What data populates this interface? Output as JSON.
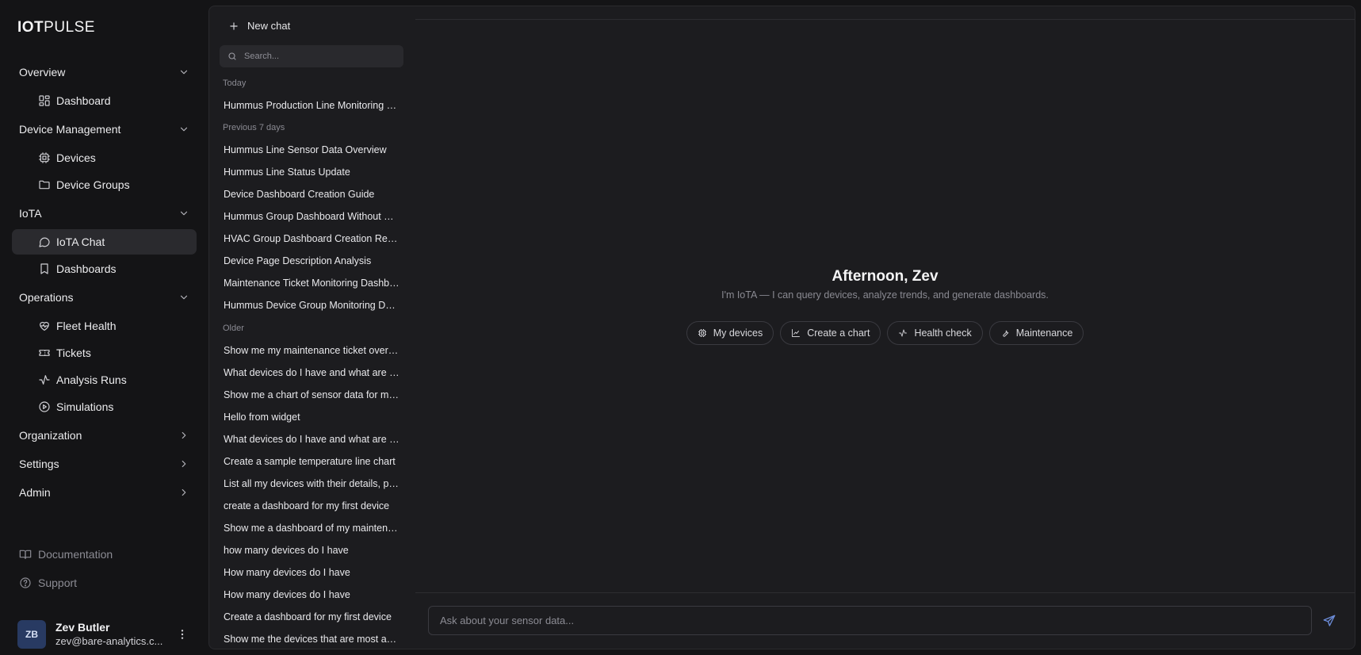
{
  "brand": {
    "bold": "IOT",
    "light": "PULSE"
  },
  "nav": {
    "groups": [
      {
        "label": "Overview",
        "items": [
          {
            "label": "Dashboard",
            "icon": "layout-dashboard-icon"
          }
        ]
      },
      {
        "label": "Device Management",
        "items": [
          {
            "label": "Devices",
            "icon": "cpu-icon"
          },
          {
            "label": "Device Groups",
            "icon": "folder-icon"
          }
        ]
      },
      {
        "label": "IoTA",
        "items": [
          {
            "label": "IoTA Chat",
            "icon": "message-circle-icon",
            "active": true
          },
          {
            "label": "Dashboards",
            "icon": "bookmark-icon"
          }
        ]
      },
      {
        "label": "Operations",
        "items": [
          {
            "label": "Fleet Health",
            "icon": "heart-pulse-icon"
          },
          {
            "label": "Tickets",
            "icon": "ticket-icon"
          },
          {
            "label": "Analysis Runs",
            "icon": "activity-icon"
          },
          {
            "label": "Simulations",
            "icon": "play-circle-icon"
          }
        ]
      },
      {
        "label": "Organization",
        "collapsed": true
      },
      {
        "label": "Settings",
        "collapsed": true
      },
      {
        "label": "Admin",
        "collapsed": true
      }
    ],
    "footer": {
      "documentation": "Documentation",
      "support": "Support"
    },
    "user": {
      "initials": "ZB",
      "name": "Zev Butler",
      "email": "zev@bare-analytics.c..."
    }
  },
  "history": {
    "new_chat": "New chat",
    "search_placeholder": "Search...",
    "sections": [
      {
        "label": "Today",
        "chats": [
          "Hummus Production Line Monitoring Dashboard"
        ]
      },
      {
        "label": "Previous 7 days",
        "chats": [
          "Hummus Line Sensor Data Overview",
          "Hummus Line Status Update",
          "Device Dashboard Creation Guide",
          "Hummus Group Dashboard Without Charts",
          "HVAC Group Dashboard Creation Request",
          "Device Page Description Analysis",
          "Maintenance Ticket Monitoring Dashboard",
          "Hummus Device Group Monitoring Dashboard"
        ]
      },
      {
        "label": "Older",
        "chats": [
          "Show me my maintenance ticket overview",
          "What devices do I have and what are they",
          "Show me a chart of sensor data for my device",
          "Hello from widget",
          "What devices do I have and what are they",
          "Create a sample temperature line chart",
          "List all my devices with their details, please",
          "create a dashboard for my first device",
          "Show me a dashboard of my maintenance tickets",
          "how many devices do I have",
          "How many devices do I have",
          "How many devices do I have",
          "Create a dashboard for my first device",
          "Show me the devices that are most active"
        ]
      }
    ]
  },
  "main": {
    "greeting": "Afternoon, Zev",
    "subtitle": "I'm IoTA — I can query devices, analyze trends, and generate dashboards.",
    "chips": [
      {
        "label": "My devices",
        "icon": "cpu-icon"
      },
      {
        "label": "Create a chart",
        "icon": "line-chart-icon"
      },
      {
        "label": "Health check",
        "icon": "activity-icon"
      },
      {
        "label": "Maintenance",
        "icon": "wrench-icon"
      }
    ],
    "input_placeholder": "Ask about your sensor data..."
  },
  "colors": {
    "background": "#141416",
    "panel": "#1c1c1f",
    "accent": "#6c8cd9",
    "avatar": "#283a62"
  }
}
